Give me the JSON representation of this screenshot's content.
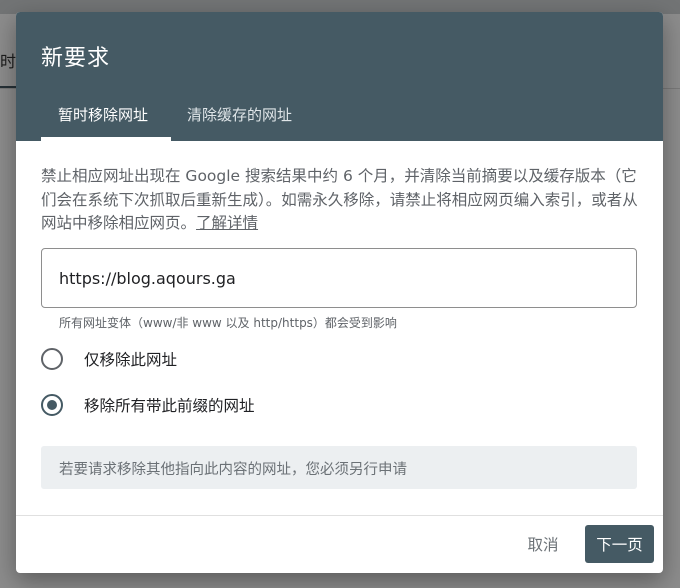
{
  "background": {
    "tab_fragment": "时"
  },
  "dialog": {
    "title": "新要求",
    "tabs": [
      {
        "label": "暂时移除网址",
        "active": true
      },
      {
        "label": "清除缓存的网址",
        "active": false
      }
    ],
    "description": "禁止相应网址出现在 Google 搜索结果中约 6 个月，并清除当前摘要以及缓存版本（它们会在系统下次抓取后重新生成）。如需永久移除，请禁止将相应网页编入索引，或者从网站中移除相应网页。",
    "learn_more": "了解详情",
    "url_input": {
      "value": "https://blog.aqours.ga"
    },
    "helper_text": "所有网址变体（www/非 www 以及 http/https）都会受到影响",
    "options": [
      {
        "label": "仅移除此网址",
        "selected": false
      },
      {
        "label": "移除所有带此前缀的网址",
        "selected": true
      }
    ],
    "notice": "若要请求移除其他指向此内容的网址，您必须另行申请",
    "actions": {
      "cancel": "取消",
      "next": "下一页"
    }
  },
  "colors": {
    "header": "#455a64",
    "notice_bg": "#eceff1",
    "primary_button": "#455a64"
  }
}
